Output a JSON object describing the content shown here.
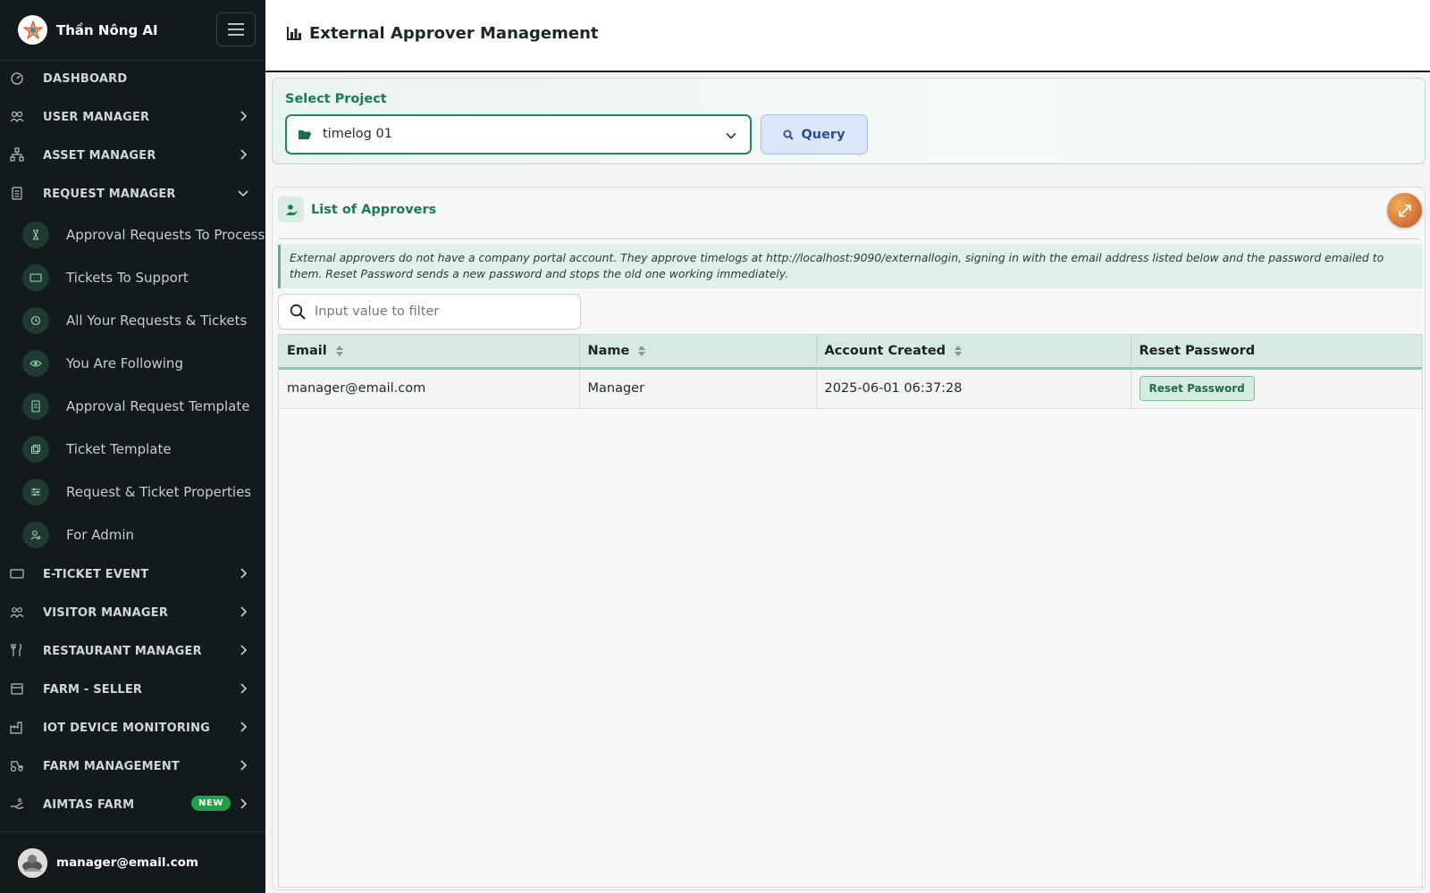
{
  "app": {
    "name": "Thần Nông AI"
  },
  "sidebar": {
    "items": [
      {
        "label": "DASHBOARD"
      },
      {
        "label": "USER MANAGER"
      },
      {
        "label": "ASSET MANAGER"
      },
      {
        "label": "REQUEST MANAGER"
      },
      {
        "label": "E-TICKET EVENT"
      },
      {
        "label": "VISITOR MANAGER"
      },
      {
        "label": "RESTAURANT MANAGER"
      },
      {
        "label": "FARM - SELLER"
      },
      {
        "label": "IOT DEVICE MONITORING"
      },
      {
        "label": "FARM MANAGEMENT"
      },
      {
        "label": "AIMTAS FARM",
        "badge": "NEW"
      }
    ],
    "request_manager_sub": [
      {
        "label": "Approval Requests To Process"
      },
      {
        "label": "Tickets To Support"
      },
      {
        "label": "All Your Requests & Tickets"
      },
      {
        "label": "You Are Following"
      },
      {
        "label": "Approval Request Template"
      },
      {
        "label": "Ticket Template"
      },
      {
        "label": "Request & Ticket Properties"
      },
      {
        "label": "For Admin"
      }
    ],
    "user": {
      "email": "manager@email.com"
    }
  },
  "header": {
    "title": "External Approver Management"
  },
  "project": {
    "label": "Select Project",
    "selected": "timelog 01",
    "query_label": "Query"
  },
  "approvers": {
    "title": "List of Approvers",
    "note": "External approvers do not have a company portal account. They approve timelogs at http://localhost:9090/externallogin, signing in with the email address listed below and the password emailed to them. Reset Password sends a new password and stops the old one working immediately.",
    "filter_placeholder": "Input value to filter",
    "columns": [
      "Email",
      "Name",
      "Account Created",
      "Reset Password"
    ],
    "rows": [
      {
        "email": "manager@email.com",
        "name": "Manager",
        "created": "2025-06-01 06:37:28",
        "action": "Reset Password"
      }
    ]
  },
  "colors": {
    "sidebar_bg": "#131a1e",
    "accent_green": "#1c7a52",
    "query_blue": "#2a4f95",
    "badge_green": "#22a04a"
  }
}
